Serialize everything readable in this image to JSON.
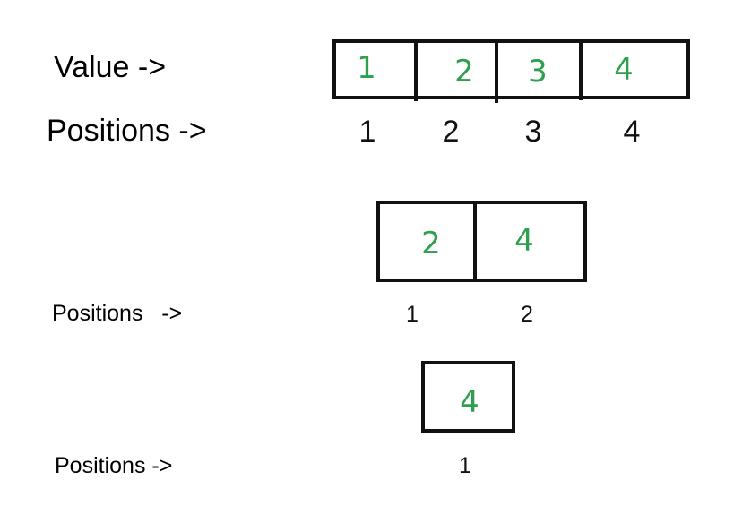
{
  "colors": {
    "value": "#2e9e4f",
    "border": "#111111",
    "text": "#000000"
  },
  "row1": {
    "value_label": "Value ->",
    "positions_label": "Positions ->",
    "values": [
      "1",
      "2",
      "3",
      "4"
    ],
    "positions": [
      "1",
      "2",
      "3",
      "4"
    ]
  },
  "row2": {
    "positions_label": "Positions   ->",
    "values": [
      "2",
      "4"
    ],
    "positions": [
      "1",
      "2"
    ]
  },
  "row3": {
    "positions_label": "Positions ->",
    "values": [
      "4"
    ],
    "positions": [
      "1"
    ]
  }
}
